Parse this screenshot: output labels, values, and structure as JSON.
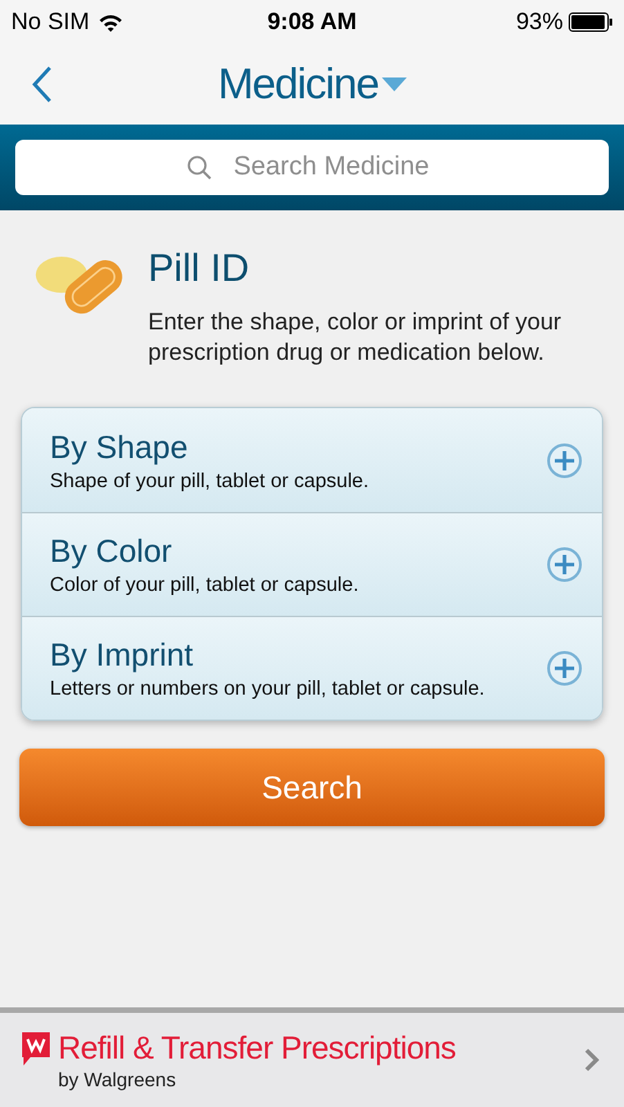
{
  "status_bar": {
    "carrier": "No SIM",
    "time": "9:08 AM",
    "battery": "93%"
  },
  "nav": {
    "title": "Medicine"
  },
  "search": {
    "placeholder": "Search Medicine"
  },
  "intro": {
    "title": "Pill ID",
    "text": "Enter the shape, color or imprint of your prescription drug or medication below."
  },
  "options": [
    {
      "title": "By Shape",
      "text": "Shape of your pill, tablet or capsule."
    },
    {
      "title": "By Color",
      "text": "Color of your pill, tablet or capsule."
    },
    {
      "title": "By Imprint",
      "text": "Letters or numbers on your pill, tablet or capsule."
    }
  ],
  "search_button": "Search",
  "banner": {
    "title": "Refill & Transfer Prescriptions",
    "subtitle": "by Walgreens"
  }
}
